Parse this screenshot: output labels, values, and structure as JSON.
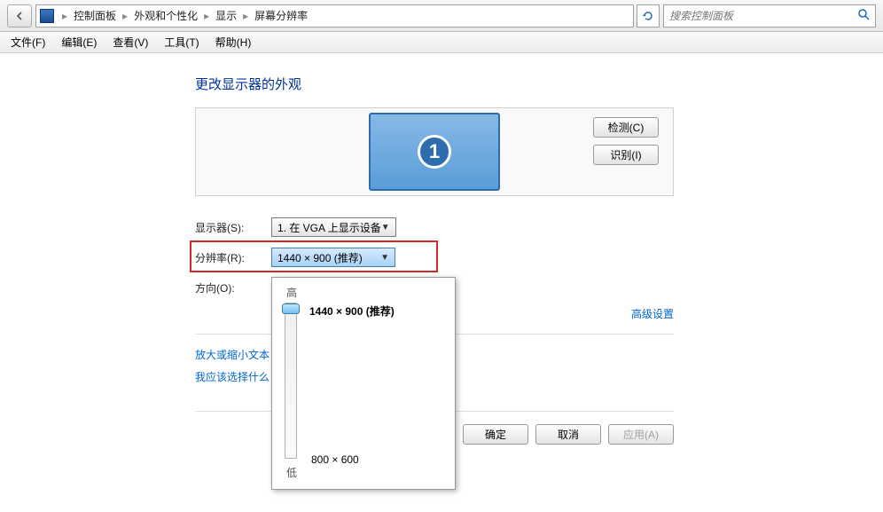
{
  "breadcrumb": {
    "items": [
      "控制面板",
      "外观和个性化",
      "显示",
      "屏幕分辨率"
    ]
  },
  "search": {
    "placeholder": "搜索控制面板"
  },
  "menu": {
    "file": "文件(F)",
    "edit": "编辑(E)",
    "view": "查看(V)",
    "tools": "工具(T)",
    "help": "帮助(H)"
  },
  "page": {
    "title": "更改显示器的外观",
    "monitor_number": "1",
    "detect_btn": "检测(C)",
    "identify_btn": "识别(I)"
  },
  "form": {
    "display_label": "显示器(S):",
    "display_value": "1. 在 VGA 上显示设备",
    "resolution_label": "分辨率(R):",
    "resolution_value": "1440 × 900 (推荐)",
    "orientation_label": "方向(O):"
  },
  "dropdown": {
    "top_label": "高",
    "bot_label": "低",
    "max_res": "1440 × 900 (推荐)",
    "min_res": "800 × 600"
  },
  "links": {
    "advanced": "高级设置",
    "zoom_text": "放大或缩小文本",
    "which_settings": "我应该选择什么"
  },
  "buttons": {
    "ok": "确定",
    "cancel": "取消",
    "apply": "应用(A)"
  }
}
